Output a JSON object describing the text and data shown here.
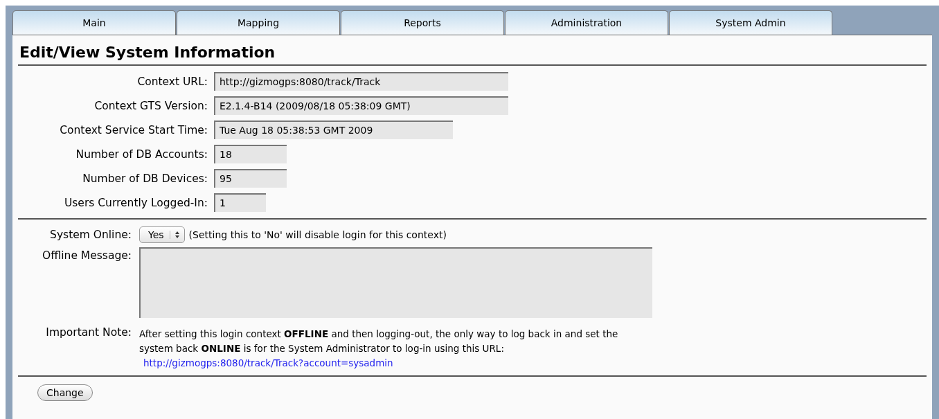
{
  "tabs": [
    {
      "label": "Main",
      "selected": false
    },
    {
      "label": "Mapping",
      "selected": false
    },
    {
      "label": "Reports",
      "selected": false
    },
    {
      "label": "Administration",
      "selected": false
    },
    {
      "label": "System Admin",
      "selected": false
    }
  ],
  "title": "Edit/View System Information",
  "info_fields": [
    {
      "label": "Context URL:",
      "value": "http://gizmogps:8080/track/Track"
    },
    {
      "label": "Context GTS Version:",
      "value": "E2.1.4-B14 (2009/08/18 05:38:09 GMT)"
    },
    {
      "label": "Context Service Start Time:",
      "value": "Tue Aug 18 05:38:53 GMT 2009"
    },
    {
      "label": "Number of DB Accounts:",
      "value": "18"
    },
    {
      "label": "Number of DB Devices:",
      "value": "95"
    },
    {
      "label": "Users Currently Logged-In:",
      "value": "1"
    }
  ],
  "system_online": {
    "label": "System Online:",
    "value": "Yes",
    "hint": "(Setting this to 'No' will disable login for this context)"
  },
  "offline_message": {
    "label": "Offline Message:"
  },
  "important_note": {
    "label": "Important Note:",
    "text": "After setting this login context **OFFLINE** and then logging-out, the only way to log back in and set the system back **ONLINE** is for the System Administrator to log-in using this URL:",
    "link": "http://gizmogps:8080/track/Track?account=sysadmin"
  },
  "buttons": [
    {
      "label": "Change"
    }
  ]
}
